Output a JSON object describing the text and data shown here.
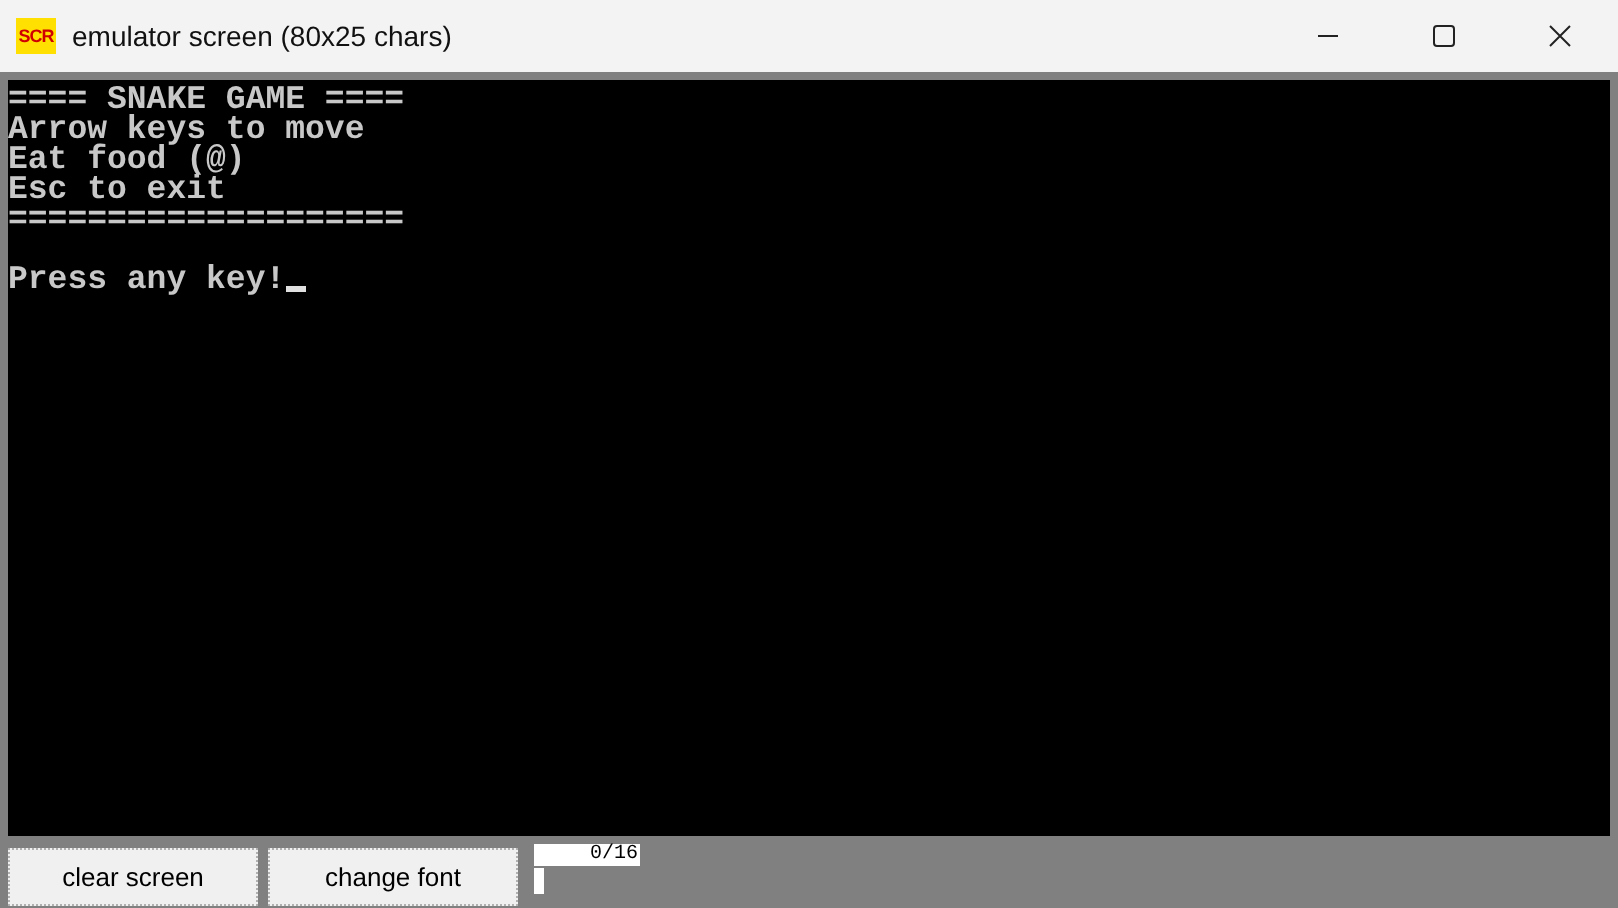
{
  "window": {
    "title": "emulator screen (80x25 chars)",
    "icon_text": "SCR"
  },
  "screen": {
    "lines": [
      {
        "kind": "text",
        "text": "==== SNAKE GAME ===="
      },
      {
        "kind": "text",
        "text": "Arrow keys to move"
      },
      {
        "kind": "text",
        "text": "Eat food (@)"
      },
      {
        "kind": "text",
        "text": "Esc to exit"
      },
      {
        "kind": "text",
        "text": "===================="
      },
      {
        "kind": "blank"
      },
      {
        "kind": "text",
        "text": "Press any key!"
      }
    ],
    "cursor": true
  },
  "buttons": [
    {
      "label": "clear screen"
    },
    {
      "label": "change font"
    }
  ],
  "counter": "0/16"
}
